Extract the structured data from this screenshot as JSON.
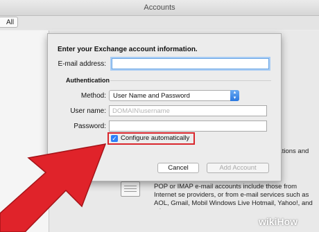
{
  "window": {
    "title": "Accounts",
    "all_label": "All"
  },
  "background": {
    "exchange_desc": "orations and",
    "pop_desc": "POP or IMAP e-mail accounts include those from Internet se providers, or from e-mail services such as AOL, Gmail, Mobil Windows Live Hotmail, Yahoo!, and others."
  },
  "dialog": {
    "heading": "Enter your Exchange account information.",
    "email_label": "E-mail address:",
    "email_value": "",
    "auth_section": "Authentication",
    "method_label": "Method:",
    "method_value": "User Name and Password",
    "username_label": "User name:",
    "username_placeholder": "DOMAIN\\username",
    "password_label": "Password:",
    "password_value": "",
    "configure_label": "Configure automatically",
    "configure_checked": true,
    "cancel_label": "Cancel",
    "add_label": "Add Account"
  },
  "watermark": {
    "wiki": "wiki",
    "how": "How"
  },
  "colors": {
    "accent": "#2d7ff9",
    "highlight": "#d9262c",
    "arrow": "#e0232a"
  }
}
